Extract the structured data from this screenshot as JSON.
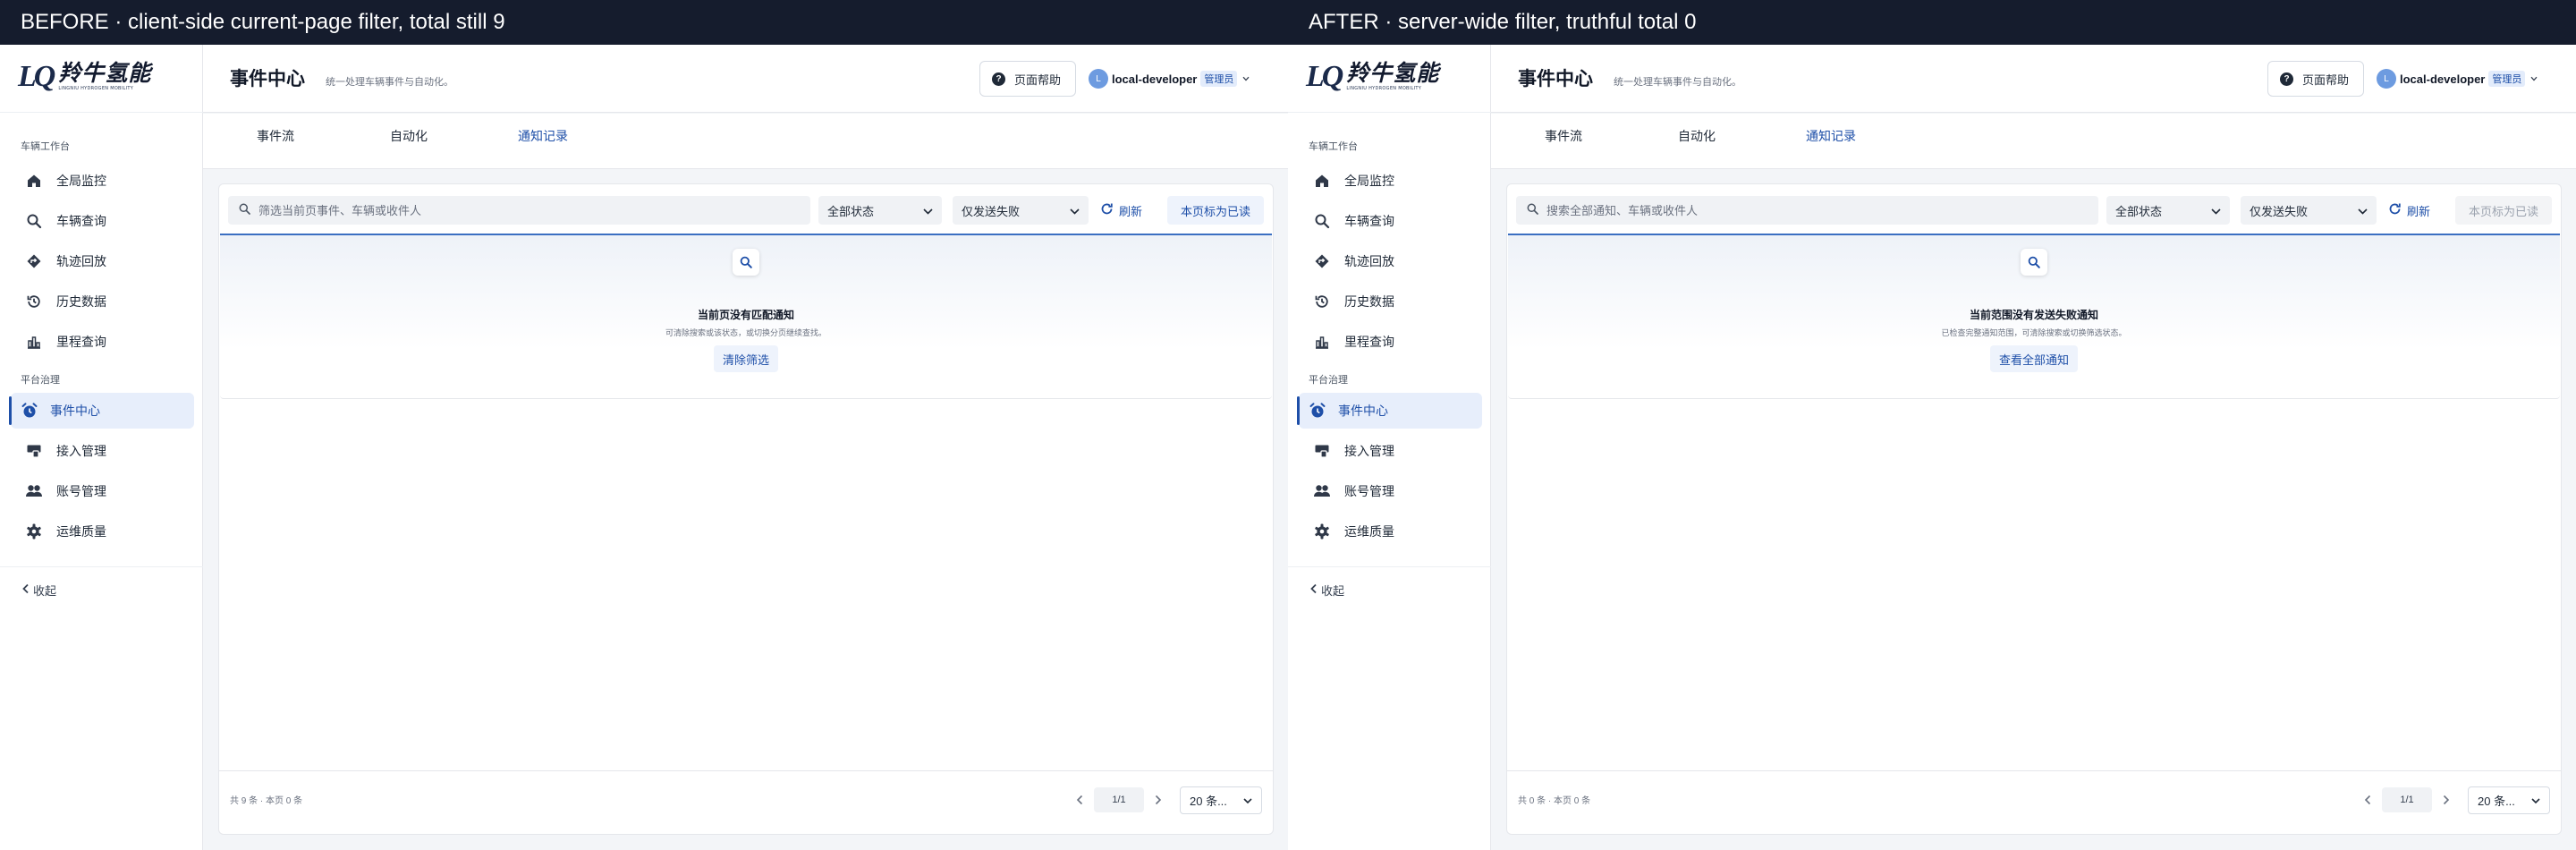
{
  "panels": [
    {
      "banner": "BEFORE · client-side current-page filter, total still 9",
      "brand": {
        "mark": "LQ",
        "name": "羚牛氢能",
        "tagline": "LINGNIU HYDROGEN MOBILITY"
      },
      "sidebar": {
        "group1": "车辆工作台",
        "items1": [
          {
            "label": "全局监控",
            "icon": "home-icon"
          },
          {
            "label": "车辆查询",
            "icon": "search-icon"
          },
          {
            "label": "轨迹回放",
            "icon": "route-icon"
          },
          {
            "label": "历史数据",
            "icon": "history-icon"
          },
          {
            "label": "里程查询",
            "icon": "bar-chart-icon"
          }
        ],
        "group2": "平台治理",
        "items2": [
          {
            "label": "事件中心",
            "icon": "alarm-clock-icon",
            "active": true
          },
          {
            "label": "接入管理",
            "icon": "access-icon"
          },
          {
            "label": "账号管理",
            "icon": "users-icon"
          },
          {
            "label": "运维质量",
            "icon": "gear-icon"
          }
        ],
        "collapse": "收起"
      },
      "header": {
        "title": "事件中心",
        "subtitle": "统一处理车辆事件与自动化。",
        "help": "页面帮助",
        "avatar_initial": "L",
        "user": "local-developer",
        "role": "管理员"
      },
      "tabs": [
        {
          "label": "事件流"
        },
        {
          "label": "自动化"
        },
        {
          "label": "通知记录",
          "active": true
        }
      ],
      "toolbar": {
        "search_placeholder": "筛选当前页事件、车辆或收件人",
        "status_select": "全部状态",
        "delivery_select": "仅发送失败",
        "refresh": "刷新",
        "mark_read": "本页标为已读",
        "mark_read_disabled": false
      },
      "empty": {
        "title": "当前页没有匹配通知",
        "desc": "可清除搜索或该状态，或切换分页继续查找。",
        "button": "清除筛选"
      },
      "footer": {
        "total": "共 9 条 · 本页 0 条",
        "page": "1/1",
        "page_size": "20 条..."
      }
    },
    {
      "banner": "AFTER · server-wide filter, truthful total 0",
      "brand": {
        "mark": "LQ",
        "name": "羚牛氢能",
        "tagline": "LINGNIU HYDROGEN MOBILITY"
      },
      "sidebar": {
        "group1": "车辆工作台",
        "items1": [
          {
            "label": "全局监控",
            "icon": "home-icon"
          },
          {
            "label": "车辆查询",
            "icon": "search-icon"
          },
          {
            "label": "轨迹回放",
            "icon": "route-icon"
          },
          {
            "label": "历史数据",
            "icon": "history-icon"
          },
          {
            "label": "里程查询",
            "icon": "bar-chart-icon"
          }
        ],
        "group2": "平台治理",
        "items2": [
          {
            "label": "事件中心",
            "icon": "alarm-clock-icon",
            "active": true
          },
          {
            "label": "接入管理",
            "icon": "access-icon"
          },
          {
            "label": "账号管理",
            "icon": "users-icon"
          },
          {
            "label": "运维质量",
            "icon": "gear-icon"
          }
        ],
        "collapse": "收起"
      },
      "header": {
        "title": "事件中心",
        "subtitle": "统一处理车辆事件与自动化。",
        "help": "页面帮助",
        "avatar_initial": "L",
        "user": "local-developer",
        "role": "管理员"
      },
      "tabs": [
        {
          "label": "事件流"
        },
        {
          "label": "自动化"
        },
        {
          "label": "通知记录",
          "active": true
        }
      ],
      "toolbar": {
        "search_placeholder": "搜索全部通知、车辆或收件人",
        "status_select": "全部状态",
        "delivery_select": "仅发送失败",
        "refresh": "刷新",
        "mark_read": "本页标为已读",
        "mark_read_disabled": true
      },
      "empty": {
        "title": "当前范围没有发送失败通知",
        "desc": "已检查完整通知范围，可清除搜索或切换筛选状态。",
        "button": "查看全部通知"
      },
      "footer": {
        "total": "共 0 条 · 本页 0 条",
        "page": "1/1",
        "page_size": "20 条..."
      }
    }
  ],
  "colors": {
    "banner": "#151c2d",
    "accent": "#1e4fa8",
    "active_bg": "#e7eefb"
  }
}
